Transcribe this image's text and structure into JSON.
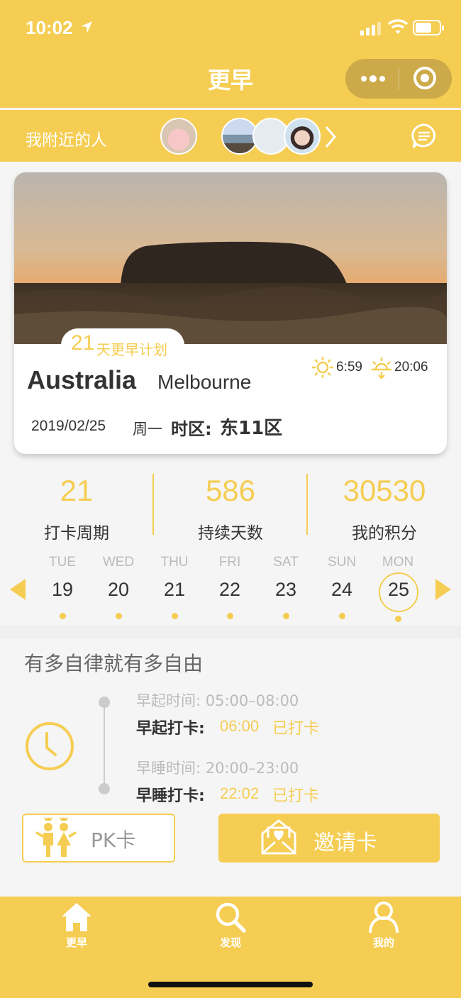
{
  "status_bar": {
    "time": "10:02",
    "icons": [
      "location-arrow-icon",
      "signal-icon",
      "wifi-icon",
      "battery-icon"
    ]
  },
  "nav": {
    "title": "更早",
    "capsule_icons": [
      "more-dots-icon",
      "target-icon"
    ]
  },
  "nearby": {
    "label": "我附近的人",
    "avatars": [
      "avatar-pig",
      "avatar-landscape",
      "avatar-snow",
      "avatar-girls"
    ]
  },
  "card": {
    "plan_days": "21",
    "plan_text": "天更早计划",
    "country": "Australia",
    "city": "Melbourne",
    "sunrise": "6:59",
    "sunset": "20:06",
    "date": "2019/02/25",
    "weekday": "周一",
    "tz_label": "时区:",
    "tz_value": "东11区"
  },
  "stats": [
    {
      "value": "21",
      "label": "打卡周期"
    },
    {
      "value": "586",
      "label": "持续天数"
    },
    {
      "value": "30530",
      "label": "我的积分"
    }
  ],
  "week": {
    "days": [
      {
        "name": "TUE",
        "num": "19"
      },
      {
        "name": "WED",
        "num": "20"
      },
      {
        "name": "THU",
        "num": "21"
      },
      {
        "name": "FRI",
        "num": "22"
      },
      {
        "name": "SAT",
        "num": "23"
      },
      {
        "name": "SUN",
        "num": "24"
      },
      {
        "name": "MON",
        "num": "25"
      }
    ],
    "selected": "25"
  },
  "schedule": {
    "motto": "有多自律就有多自由",
    "wake_range": "早起时间: 05:00–08:00",
    "wake_label": "早起打卡:",
    "wake_time": "06:00",
    "wake_state": "已打卡",
    "sleep_range": "早睡时间: 20:00–23:00",
    "sleep_label": "早睡打卡:",
    "sleep_time": "22:02",
    "sleep_state": "已打卡"
  },
  "buttons": {
    "pk": "PK卡",
    "invite": "邀请卡"
  },
  "tabbar": [
    {
      "label": "更早",
      "icon": "home-icon"
    },
    {
      "label": "发现",
      "icon": "search-icon"
    },
    {
      "label": "我的",
      "icon": "person-icon"
    }
  ],
  "colors": {
    "accent": "#f5cd52",
    "text": "#333333",
    "muted": "#bbbbbb"
  }
}
